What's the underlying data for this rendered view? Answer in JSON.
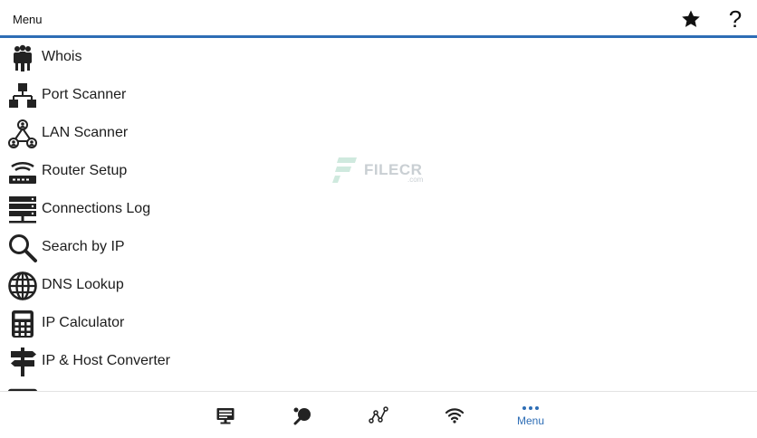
{
  "header": {
    "title": "Menu",
    "favorite_icon": "star-icon",
    "help_icon": "help-icon",
    "help_glyph": "?"
  },
  "menu": {
    "items": [
      {
        "label": "Whois",
        "icon": "people-icon"
      },
      {
        "label": "Port Scanner",
        "icon": "network-hierarchy-icon"
      },
      {
        "label": "LAN Scanner",
        "icon": "lan-users-icon"
      },
      {
        "label": "Router Setup",
        "icon": "router-icon"
      },
      {
        "label": "Connections Log",
        "icon": "server-icon"
      },
      {
        "label": "Search by IP",
        "icon": "search-icon"
      },
      {
        "label": "DNS Lookup",
        "icon": "globe-icon"
      },
      {
        "label": "IP Calculator",
        "icon": "calculator-icon"
      },
      {
        "label": "IP & Host Converter",
        "icon": "signpost-icon"
      }
    ]
  },
  "watermark": {
    "text": "FILECR",
    "sub": ".com"
  },
  "bottom_nav": {
    "tabs": [
      {
        "icon": "display-icon"
      },
      {
        "icon": "ping-pong-icon"
      },
      {
        "icon": "graph-icon"
      },
      {
        "icon": "wifi-icon"
      },
      {
        "icon": "more-dots-icon",
        "label": "Menu",
        "active": true
      }
    ],
    "accent_color": "#2d6db5"
  }
}
